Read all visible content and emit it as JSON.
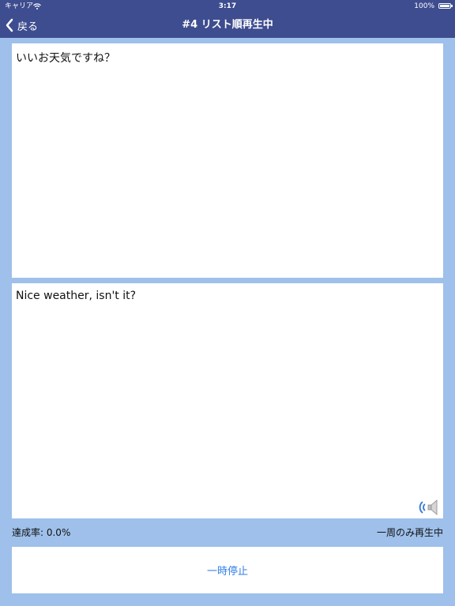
{
  "status_bar": {
    "carrier": "キャリア",
    "time": "3:17",
    "battery_percent": "100%"
  },
  "nav": {
    "back_label": "戻る",
    "title": "#4 リスト順再生中"
  },
  "cards": {
    "japanese_text": "いいお天気ですね？",
    "english_text": "Nice weather, isn't it?"
  },
  "info": {
    "progress": "達成率: 0.0%",
    "mode": "一周のみ再生中"
  },
  "controls": {
    "pause_label": "一時停止"
  },
  "colors": {
    "nav_bar": "#3e4d8f",
    "background": "#9ec0ea",
    "accent": "#2f7ee6"
  },
  "icons": {
    "back": "chevron-left-icon",
    "speaker": "speaker-icon",
    "wifi": "wifi-icon",
    "battery": "battery-icon"
  }
}
